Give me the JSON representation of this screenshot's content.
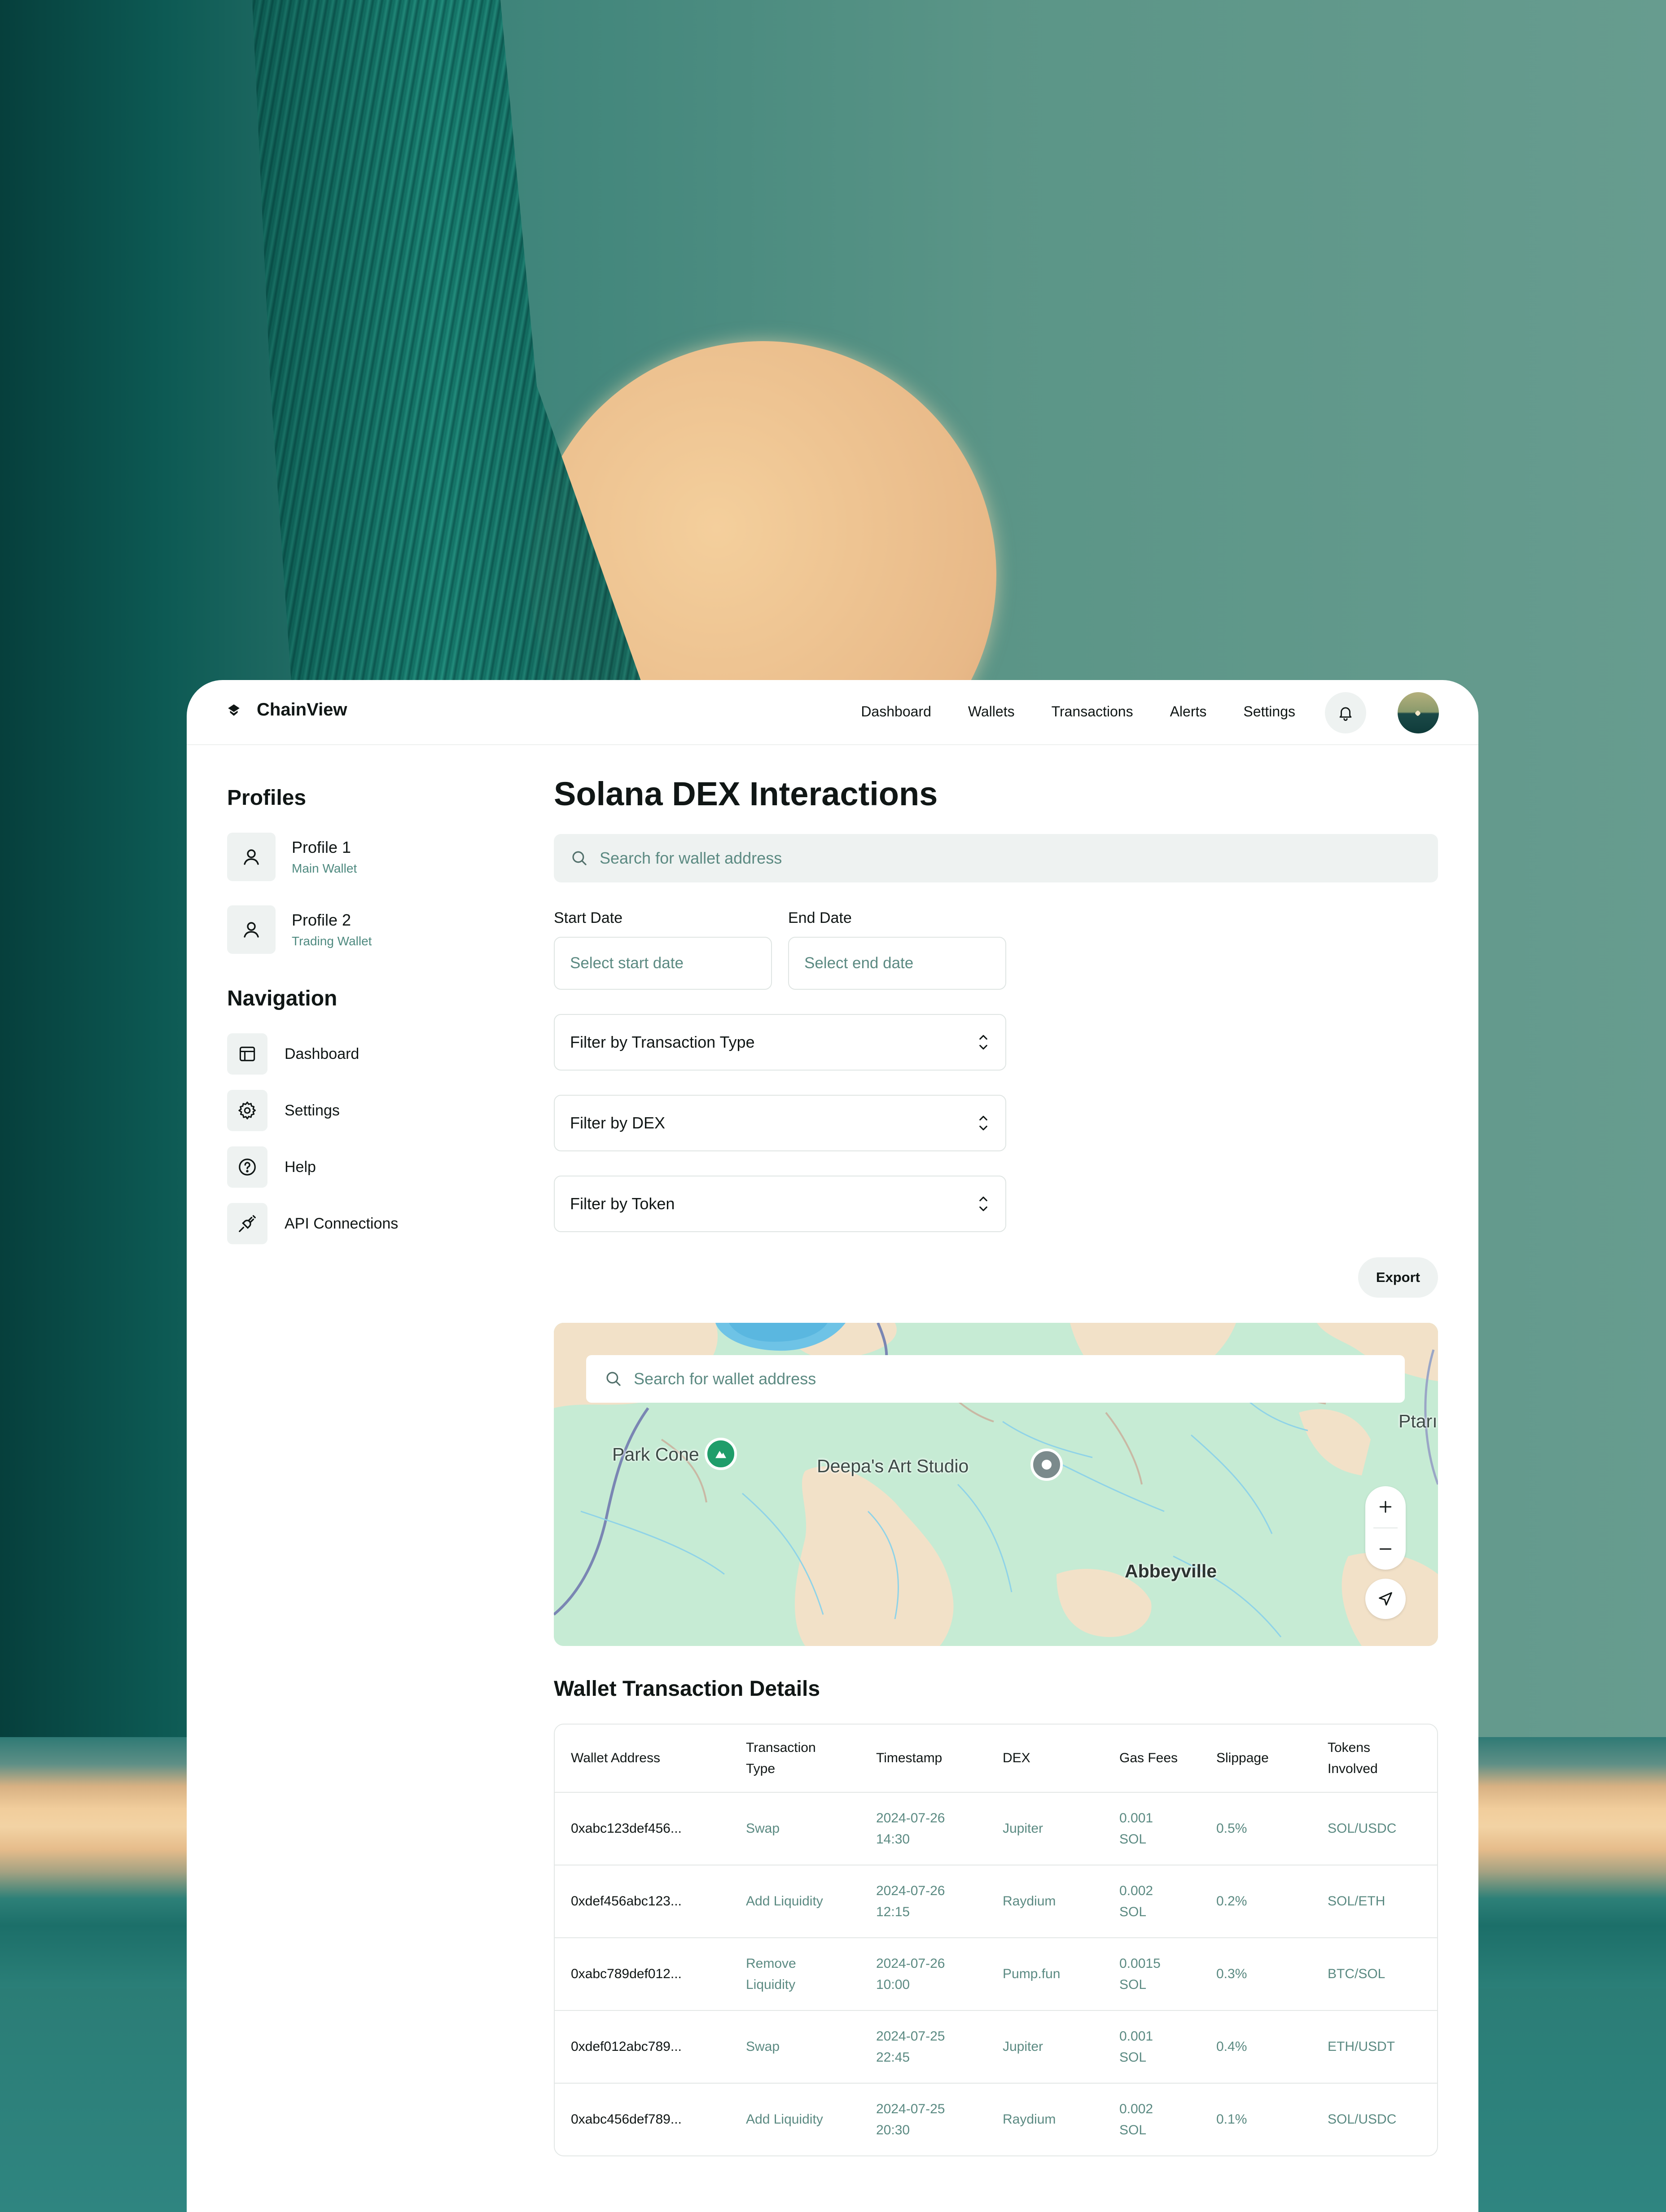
{
  "brand": {
    "name": "ChainView"
  },
  "nav": {
    "links": [
      "Dashboard",
      "Wallets",
      "Transactions",
      "Alerts",
      "Settings"
    ]
  },
  "sidebar": {
    "profiles_heading": "Profiles",
    "profiles": [
      {
        "name": "Profile 1",
        "sub": "Main Wallet"
      },
      {
        "name": "Profile 2",
        "sub": "Trading Wallet"
      }
    ],
    "navigation_heading": "Navigation",
    "items": [
      {
        "label": "Dashboard",
        "icon": "layout-icon"
      },
      {
        "label": "Settings",
        "icon": "gear-icon"
      },
      {
        "label": "Help",
        "icon": "help-circle-icon"
      },
      {
        "label": "API Connections",
        "icon": "plug-icon"
      }
    ]
  },
  "main": {
    "title": "Solana DEX Interactions",
    "search_placeholder": "Search for wallet address",
    "start_date": {
      "label": "Start Date",
      "placeholder": "Select start date"
    },
    "end_date": {
      "label": "End Date",
      "placeholder": "Select end date"
    },
    "filters": [
      "Filter by Transaction Type",
      "Filter by DEX",
      "Filter by Token"
    ],
    "export_label": "Export"
  },
  "map": {
    "search_placeholder": "Search for wallet address",
    "labels": {
      "park": "Park Cone",
      "studio": "Deepa's Art Studio",
      "town": "Abbeyville",
      "edge": "Ptarı"
    }
  },
  "table": {
    "title": "Wallet Transaction Details",
    "columns": [
      "Wallet Address",
      "Transaction Type",
      "Timestamp",
      "DEX",
      "Gas Fees",
      "Slippage",
      "Tokens Involved"
    ],
    "rows": [
      [
        "0xabc123def456...",
        "Swap",
        "2024-07-26 14:30",
        "Jupiter",
        "0.001 SOL",
        "0.5%",
        "SOL/USDC"
      ],
      [
        "0xdef456abc123...",
        "Add Liquidity",
        "2024-07-26 12:15",
        "Raydium",
        "0.002 SOL",
        "0.2%",
        "SOL/ETH"
      ],
      [
        "0xabc789def012...",
        "Remove Liquidity",
        "2024-07-26 10:00",
        "Pump.fun",
        "0.0015 SOL",
        "0.3%",
        "BTC/SOL"
      ],
      [
        "0xdef012abc789...",
        "Swap",
        "2024-07-25 22:45",
        "Jupiter",
        "0.001 SOL",
        "0.4%",
        "ETH/USDT"
      ],
      [
        "0xabc456def789...",
        "Add Liquidity",
        "2024-07-25 20:30",
        "Raydium",
        "0.002 SOL",
        "0.1%",
        "SOL/USDC"
      ]
    ]
  },
  "colors": {
    "accent_text": "#5b8a82",
    "tile_bg": "#eef2f1",
    "park_pin": "#1f9d6a",
    "studio_pin": "#7b8a8c"
  }
}
